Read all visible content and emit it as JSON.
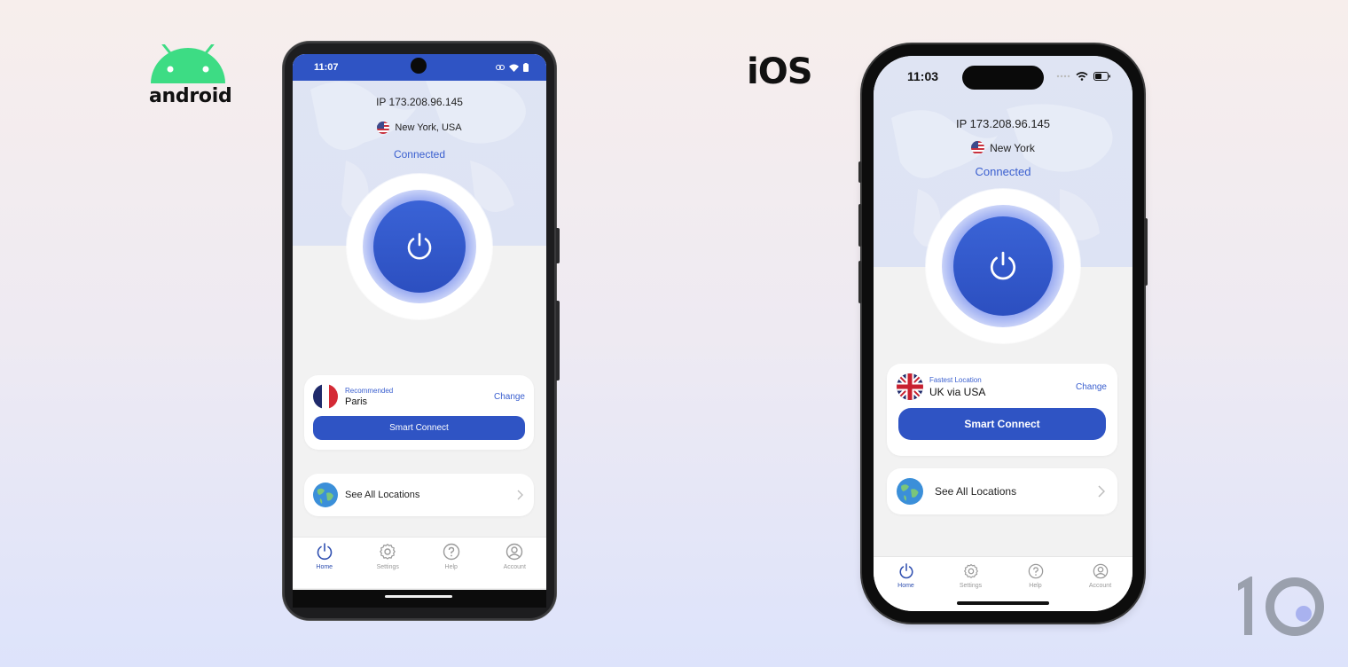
{
  "platforms": {
    "android_label": "android",
    "ios_label": "iOS"
  },
  "colors": {
    "accent": "#2f54c4",
    "android_green": "#3ddc84",
    "link": "#3a5fcf"
  },
  "android": {
    "status_bar": {
      "time": "11:07",
      "icons": [
        "link-icon",
        "wifi-icon",
        "battery-icon"
      ]
    },
    "ip": "IP 173.208.96.145",
    "location": {
      "flag": "us-flag",
      "name": "New York, USA"
    },
    "status": "Connected",
    "power_button": {
      "icon": "power-icon",
      "state": "on"
    },
    "recommended_card": {
      "label": "Recommended",
      "location": "Paris",
      "flag": "france-flag",
      "change_label": "Change",
      "button_label": "Smart Connect"
    },
    "locations_card": {
      "label": "See All Locations",
      "icon": "globe-icon"
    },
    "tabs": [
      {
        "label": "Home",
        "icon": "power-icon",
        "active": true
      },
      {
        "label": "Settings",
        "icon": "gear-icon",
        "active": false
      },
      {
        "label": "Help",
        "icon": "help-icon",
        "active": false
      },
      {
        "label": "Account",
        "icon": "user-icon",
        "active": false
      }
    ]
  },
  "ios": {
    "status_bar": {
      "time": "11:03",
      "icons": [
        "signal-icon",
        "wifi-icon",
        "battery-icon"
      ]
    },
    "ip": "IP 173.208.96.145",
    "location": {
      "flag": "us-flag",
      "name": "New York"
    },
    "status": "Connected",
    "power_button": {
      "icon": "power-icon",
      "state": "on"
    },
    "recommended_card": {
      "label": "Fastest Location",
      "location": "UK via USA",
      "flag": "uk-flag",
      "change_label": "Change",
      "button_label": "Smart Connect"
    },
    "locations_card": {
      "label": "See All Locations",
      "icon": "globe-icon"
    },
    "tabs": [
      {
        "label": "Home",
        "icon": "power-icon",
        "active": true
      },
      {
        "label": "Settings",
        "icon": "gear-icon",
        "active": false
      },
      {
        "label": "Help",
        "icon": "help-icon",
        "active": false
      },
      {
        "label": "Account",
        "icon": "user-icon",
        "active": false
      }
    ]
  },
  "brand_mark": "10"
}
